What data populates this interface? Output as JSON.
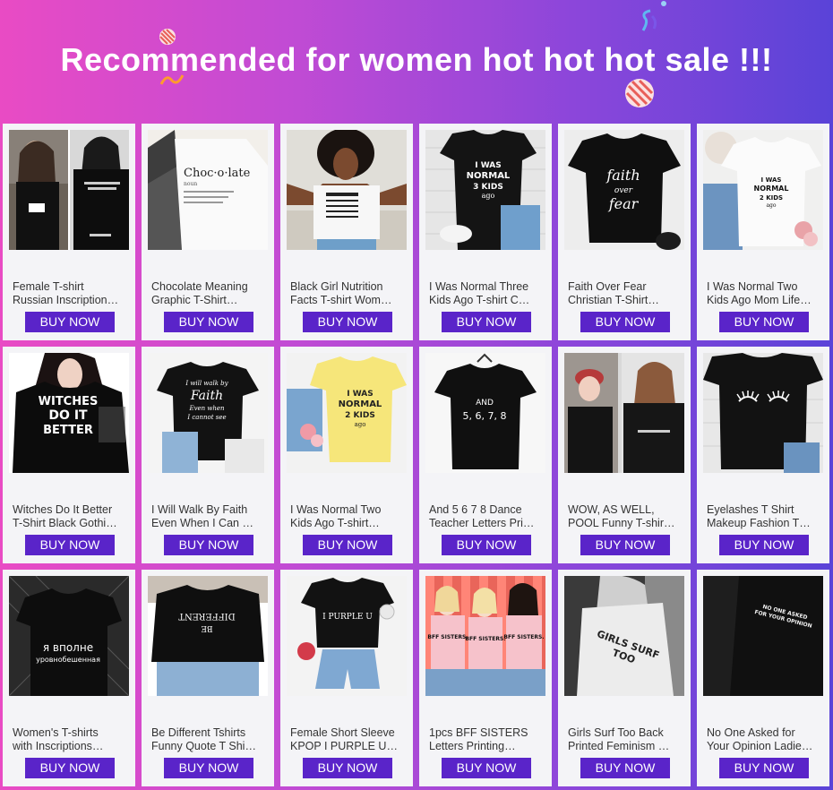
{
  "header": {
    "title": "Recommended for women hot hot hot sale !!!"
  },
  "products": [
    {
      "line1": "Female T-shirt",
      "line2": "Russian Inscription…",
      "button": "BUY NOW",
      "image": "photo-two-women-black-tees"
    },
    {
      "line1": "Chocolate Meaning",
      "line2": "Graphic T-Shirt…",
      "button": "BUY NOW",
      "image": "photo-white-tee-choco-late"
    },
    {
      "line1": "Black Girl Nutrition",
      "line2": "Facts T-shirt Wom…",
      "button": "BUY NOW",
      "image": "photo-woman-white-tee-nutrition"
    },
    {
      "line1": "I Was Normal Three",
      "line2": "Kids Ago T-shirt C…",
      "button": "BUY NOW",
      "image": "photo-black-tee-jeans-flatlay"
    },
    {
      "line1": "Faith Over Fear",
      "line2": "Christian T-Shirt…",
      "button": "BUY NOW",
      "image": "photo-black-tee-faith-over-fear"
    },
    {
      "line1": "I Was Normal Two",
      "line2": "Kids Ago Mom Life…",
      "button": "BUY NOW",
      "image": "photo-white-tee-flatlay"
    },
    {
      "line1": "Witches Do It Better",
      "line2": "T-Shirt Black Gothi…",
      "button": "BUY NOW",
      "image": "photo-woman-black-tee-witches"
    },
    {
      "line1": "I Will Walk By Faith",
      "line2": "Even When I Can …",
      "button": "BUY NOW",
      "image": "photo-black-tee-walk-by-faith"
    },
    {
      "line1": "I Was Normal Two",
      "line2": "Kids Ago T-shirt…",
      "button": "BUY NOW",
      "image": "photo-yellow-tee-flatlay"
    },
    {
      "line1": "And 5 6 7 8 Dance",
      "line2": "Teacher Letters Pri…",
      "button": "BUY NOW",
      "image": "photo-black-tee-hanger"
    },
    {
      "line1": "WOW, AS WELL,",
      "line2": "POOL Funny T-shir…",
      "button": "BUY NOW",
      "image": "photo-collage-women-black-tees"
    },
    {
      "line1": "Eyelashes T Shirt",
      "line2": "Makeup Fashion T…",
      "button": "BUY NOW",
      "image": "photo-black-tee-eyelashes"
    },
    {
      "line1": "Women's T-shirts",
      "line2": "with Inscriptions…",
      "button": "BUY NOW",
      "image": "photo-black-tee-russian-text"
    },
    {
      "line1": "Be Different Tshirts",
      "line2": "Funny Quote T Shi…",
      "button": "BUY NOW",
      "image": "photo-woman-black-tee-be-different"
    },
    {
      "line1": "Female Short Sleeve",
      "line2": "KPOP I PURPLE U…",
      "button": "BUY NOW",
      "image": "photo-black-tee-shorts-flatlay"
    },
    {
      "line1": "1pcs BFF SISTERS",
      "line2": "Letters Printing…",
      "button": "BUY NOW",
      "image": "photo-three-women-pink-tees"
    },
    {
      "line1": "Girls Surf Too Back",
      "line2": "Printed Feminism …",
      "button": "BUY NOW",
      "image": "photo-woman-back-white-tee"
    },
    {
      "line1": "No One Asked for",
      "line2": "Your Opinion Ladie…",
      "button": "BUY NOW",
      "image": "photo-black-tee-no-one-asked"
    }
  ],
  "thumb_text": {
    "choco_title": "Choc·o·late",
    "choco_sub": "noun",
    "nutrition": "Black Girl Nutrition Facts",
    "normal3": [
      "I WAS",
      "NORMAL",
      "3 KIDS",
      "ago"
    ],
    "faith": [
      "faith",
      "over",
      "fear"
    ],
    "normal2": [
      "I WAS",
      "NORMAL",
      "2 KIDS",
      "ago"
    ],
    "witches": [
      "WITCHES",
      "DO IT",
      "BETTER"
    ],
    "walk": [
      "I will walk by",
      "Faith",
      "Even when",
      "I cannot see"
    ],
    "normal2y": [
      "I WAS",
      "NORMAL",
      "2 KIDS",
      "ago"
    ],
    "dance": [
      "AND",
      "5, 6, 7, 8"
    ],
    "russian": [
      "я вполне",
      "уровнобешенная"
    ],
    "be_different": [
      "BE",
      "DIFFERENT"
    ],
    "purple": "I PURPLE U",
    "bff": [
      "BFF SISTERS.",
      "BFF SISTERS.",
      "BFF SISTERS."
    ],
    "surf": [
      "GIRLS SURF",
      "TOO"
    ],
    "noone": [
      "NO ONE ASKED",
      "FOR YOUR OPINION"
    ]
  },
  "colors": {
    "button_bg": "#5a24c9",
    "card_bg": "#f4f4f7",
    "gradient_left": "#e94bc4",
    "gradient_right": "#5a43d8"
  }
}
